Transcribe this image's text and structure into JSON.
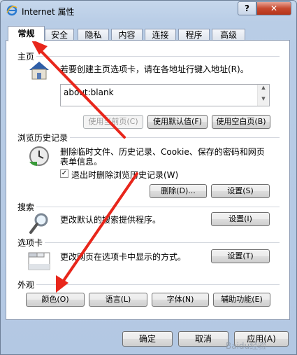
{
  "window": {
    "title": "Internet 属性",
    "help_label": "?",
    "close_label": "✕"
  },
  "tabs": [
    {
      "label": "常规",
      "active": true
    },
    {
      "label": "安全"
    },
    {
      "label": "隐私"
    },
    {
      "label": "内容"
    },
    {
      "label": "连接"
    },
    {
      "label": "程序"
    },
    {
      "label": "高级"
    }
  ],
  "home": {
    "title": "主页",
    "description": "若要创建主页选项卡，请在各地址行键入地址(R)。",
    "url": "about:blank",
    "use_current": "使用当前页(C)",
    "use_default": "使用默认值(F)",
    "use_blank": "使用空白页(B)"
  },
  "history": {
    "title": "浏览历史记录",
    "description_line1": "删除临时文件、历史记录、Cookie、保存的密码和网页",
    "description_line2": "表单信息。",
    "checkbox_label": "退出时删除浏览历史记录(W)",
    "checkbox_checked": true,
    "delete_button": "删除(D)...",
    "settings_button": "设置(S)"
  },
  "search": {
    "title": "搜索",
    "description": "更改默认的搜索提供程序。",
    "settings_button": "设置(I)"
  },
  "tabs_section": {
    "title": "选项卡",
    "description": "更改网页在选项卡中显示的方式。",
    "settings_button": "设置(T)"
  },
  "appearance": {
    "title": "外观",
    "colors_button": "颜色(O)",
    "languages_button": "语言(L)",
    "fonts_button": "字体(N)",
    "accessibility_button": "辅助功能(E)"
  },
  "footer": {
    "ok": "确定",
    "cancel": "取消",
    "apply": "应用(A)"
  },
  "watermark": "Baidu经验",
  "colors": {
    "arrow": "#e8261b",
    "close_button": "#c7492f"
  },
  "icons": [
    "ie-icon",
    "home-icon",
    "history-icon",
    "search-icon",
    "tabs-icon"
  ]
}
